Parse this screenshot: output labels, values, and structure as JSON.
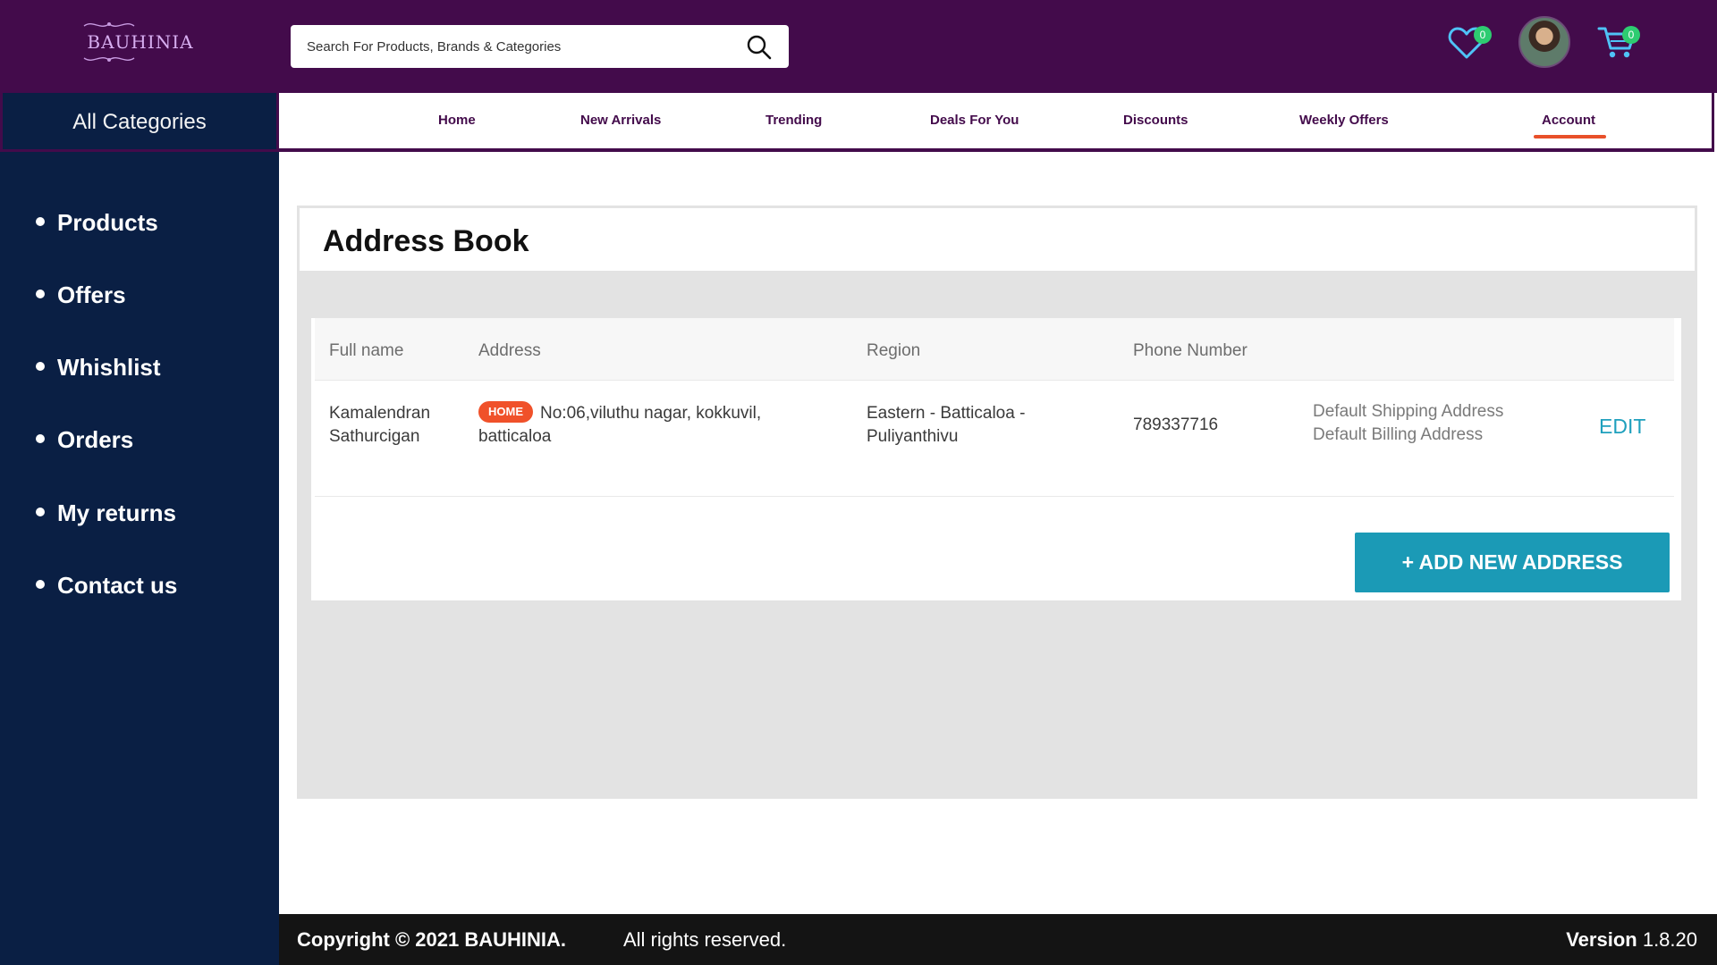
{
  "header": {
    "logo_text": "BAUHINIA",
    "search_placeholder": "Search For Products, Brands & Categories",
    "wishlist_count": "0",
    "cart_count": "0"
  },
  "category_bar": {
    "label": "All Categories"
  },
  "nav": {
    "items": [
      "Home",
      "New Arrivals",
      "Trending",
      "Deals For You",
      "Discounts",
      "Weekly Offers",
      "Account"
    ],
    "active": "Account"
  },
  "sidebar": {
    "items": [
      "Products",
      "Offers",
      "Whishlist",
      "Orders",
      "My returns",
      "Contact us"
    ]
  },
  "address_book": {
    "title": "Address Book",
    "columns": [
      "Full name",
      "Address",
      "Region",
      "Phone Number"
    ],
    "rows": [
      {
        "full_name_line1": "Kamalendran",
        "full_name_line2": "Sathurcigan",
        "tag": "HOME",
        "address_line1": "No:06,viluthu nagar, kokkuvil,",
        "address_line2": "batticaloa",
        "region_line1": "Eastern - Batticaloa -",
        "region_line2": "Puliyanthivu",
        "phone": "789337716",
        "default_shipping": "Default Shipping Address",
        "default_billing": "Default Billing Address",
        "edit_label": "EDIT"
      }
    ],
    "add_button": "+ ADD NEW ADDRESS"
  },
  "footer": {
    "copyright": "Copyright © 2021 BAUHINIA.",
    "rights": "All rights reserved.",
    "version_label": "Version",
    "version_number": "1.8.20"
  },
  "colors": {
    "header_bg": "#430b4b",
    "sidebar_bg": "#0a1f44",
    "accent_orange": "#e8502a",
    "button_teal": "#1b9ab6",
    "badge_green": "#2ecc71",
    "footer_bg": "#141414"
  },
  "icons": [
    "search-icon",
    "heart-icon",
    "avatar",
    "cart-icon"
  ]
}
